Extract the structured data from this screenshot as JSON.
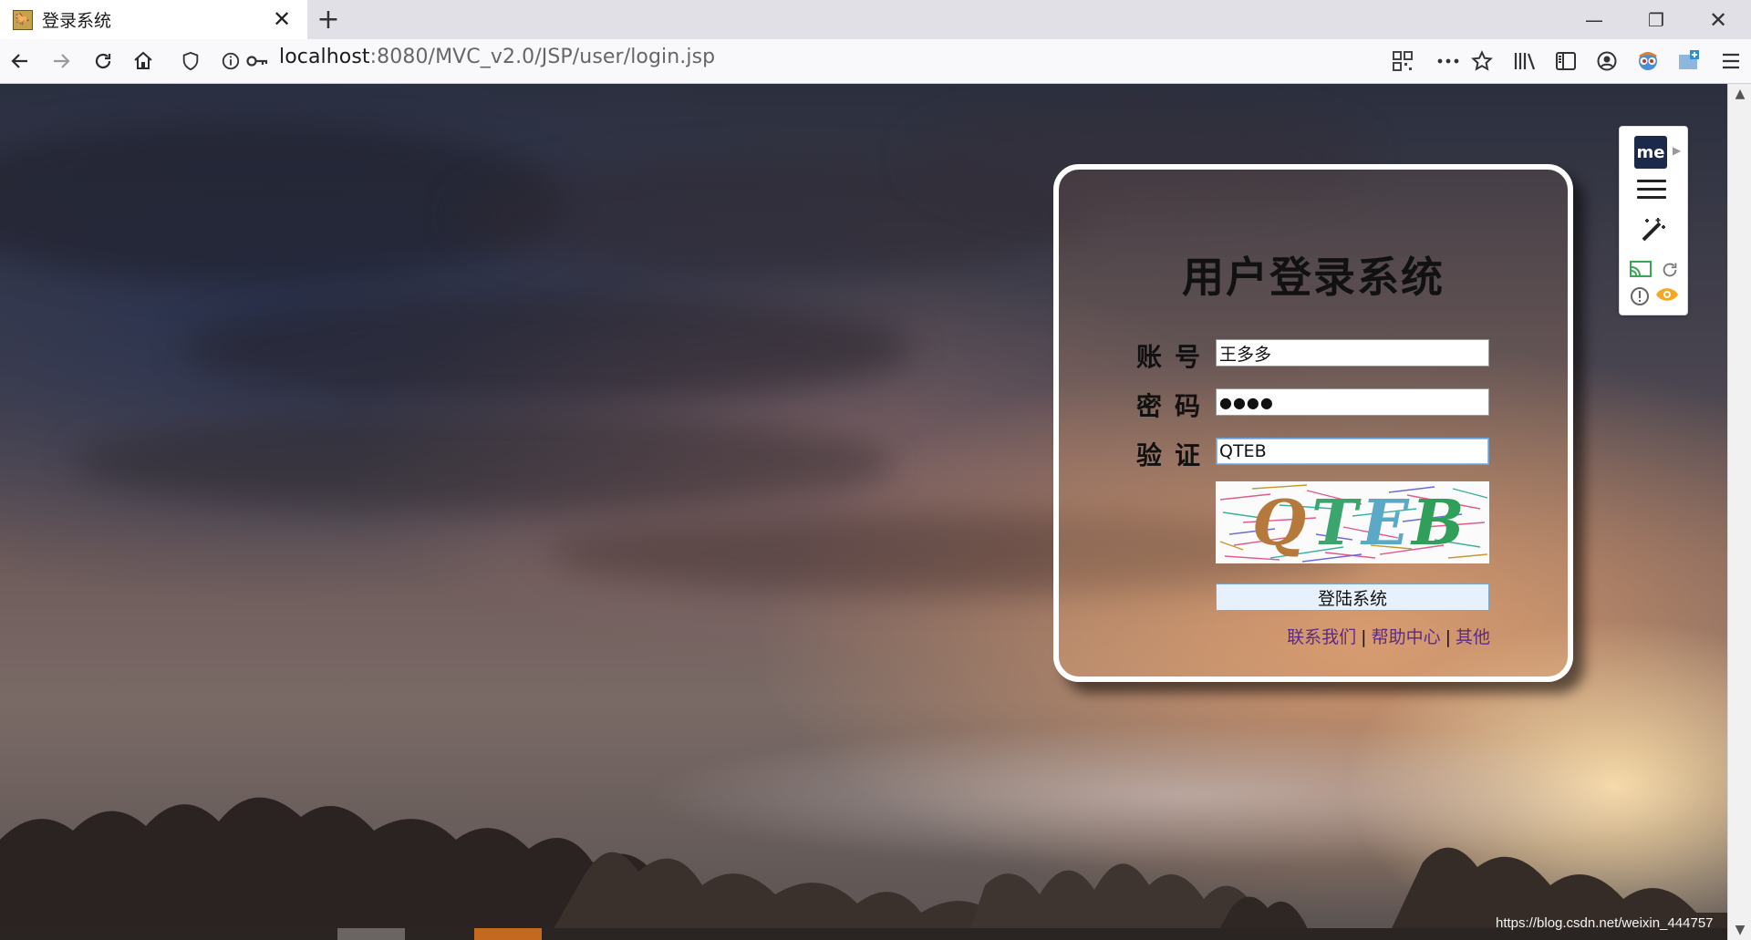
{
  "browser": {
    "tab_title": "登录系统",
    "tab_close": "✕",
    "new_tab": "+",
    "window": {
      "minimize": "—",
      "restore": "❐",
      "close": "✕"
    },
    "url_host": "localhost",
    "url_rest": ":8080/MVC_v2.0/JSP/user/login.jsp",
    "toolbar_icons": [
      "back-icon",
      "forward-icon",
      "reload-icon",
      "home-icon",
      "shield-icon",
      "info-icon",
      "key-icon",
      "qr-icon",
      "more-icon",
      "star-icon",
      "library-icon",
      "sidebar-icon",
      "account-icon",
      "extension-icon",
      "screenshot-icon",
      "menu-icon"
    ]
  },
  "extension_panel": {
    "logo_text": "me"
  },
  "login": {
    "title": "用户登录系统",
    "account_label": "账号",
    "account_value": "王多多",
    "password_label": "密码",
    "password_value": "●●●●",
    "verify_label": "验证",
    "verify_value": "QTEB",
    "captcha_text": [
      "Q",
      "T",
      "E",
      "B"
    ],
    "submit_label": "登陆系统",
    "links": [
      "联系我们",
      "帮助中心",
      "其他"
    ],
    "link_separator": "|"
  },
  "watermark": "https://blog.csdn.net/weixin_444757",
  "colors": {
    "link": "#5a2a8a",
    "button_bg": "#e6f1fb",
    "card_border": "#ffffff"
  }
}
